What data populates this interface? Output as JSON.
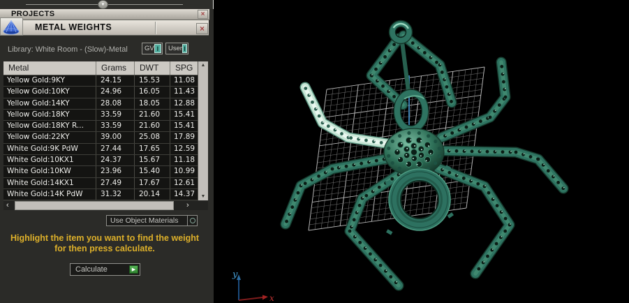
{
  "panel": {
    "projects_title": "PROJECTS",
    "metal_weights_title": "METAL WEIGHTS",
    "library": {
      "label": "Library: White Room - (Slow)-Metal",
      "gv": {
        "label": "GV",
        "indicator": "I"
      },
      "user": {
        "label": "User",
        "indicator": "I"
      }
    },
    "table": {
      "columns": [
        "Metal",
        "Grams",
        "DWT",
        "SPG"
      ],
      "rows": [
        {
          "metal": "Yellow Gold:9KY",
          "grams": "24.15",
          "dwt": "15.53",
          "spg": "11.08"
        },
        {
          "metal": "Yellow Gold:10KY",
          "grams": "24.96",
          "dwt": "16.05",
          "spg": "11.43"
        },
        {
          "metal": "Yellow Gold:14KY",
          "grams": "28.08",
          "dwt": "18.05",
          "spg": "12.88"
        },
        {
          "metal": "Yellow Gold:18KY",
          "grams": "33.59",
          "dwt": "21.60",
          "spg": "15.41"
        },
        {
          "metal": "Yellow Gold:18KY R...",
          "grams": "33.59",
          "dwt": "21.60",
          "spg": "15.41"
        },
        {
          "metal": "Yellow Gold:22KY",
          "grams": "39.00",
          "dwt": "25.08",
          "spg": "17.89"
        },
        {
          "metal": "White Gold:9K PdW",
          "grams": "27.44",
          "dwt": "17.65",
          "spg": "12.59"
        },
        {
          "metal": "White Gold:10KX1",
          "grams": "24.37",
          "dwt": "15.67",
          "spg": "11.18"
        },
        {
          "metal": "White Gold:10KW",
          "grams": "23.96",
          "dwt": "15.40",
          "spg": "10.99"
        },
        {
          "metal": "White Gold:14KX1",
          "grams": "27.49",
          "dwt": "17.67",
          "spg": "12.61"
        },
        {
          "metal": "White Gold:14K PdW",
          "grams": "31.32",
          "dwt": "20.14",
          "spg": "14.37"
        }
      ]
    },
    "materials_selector": {
      "label": "Use Object Materials"
    },
    "instruction": {
      "line1": "Highlight the item you want to find the weight",
      "line2": "for then press calculate."
    },
    "calculate": {
      "label": "Calculate"
    }
  },
  "viewport": {
    "axis": {
      "x": "x",
      "y": "y"
    }
  },
  "icons": {
    "close": "×",
    "slider_knob": "▼",
    "scroll_up": "▲",
    "scroll_down": "▼",
    "scroll_left": "‹",
    "scroll_right": "›",
    "calculate_play": "▶"
  },
  "colors": {
    "accent_teal": "#53b0a1",
    "spider_teal": "#2e7361",
    "spider_highlight": "#cde9db",
    "instruction_yellow": "#ddb02a",
    "close_red": "#a34545",
    "axis_x_red": "#c23434",
    "axis_y_blue": "#46a0d8",
    "grid_gray": "#6a6a6a",
    "calculate_green": "#3fa03f"
  }
}
